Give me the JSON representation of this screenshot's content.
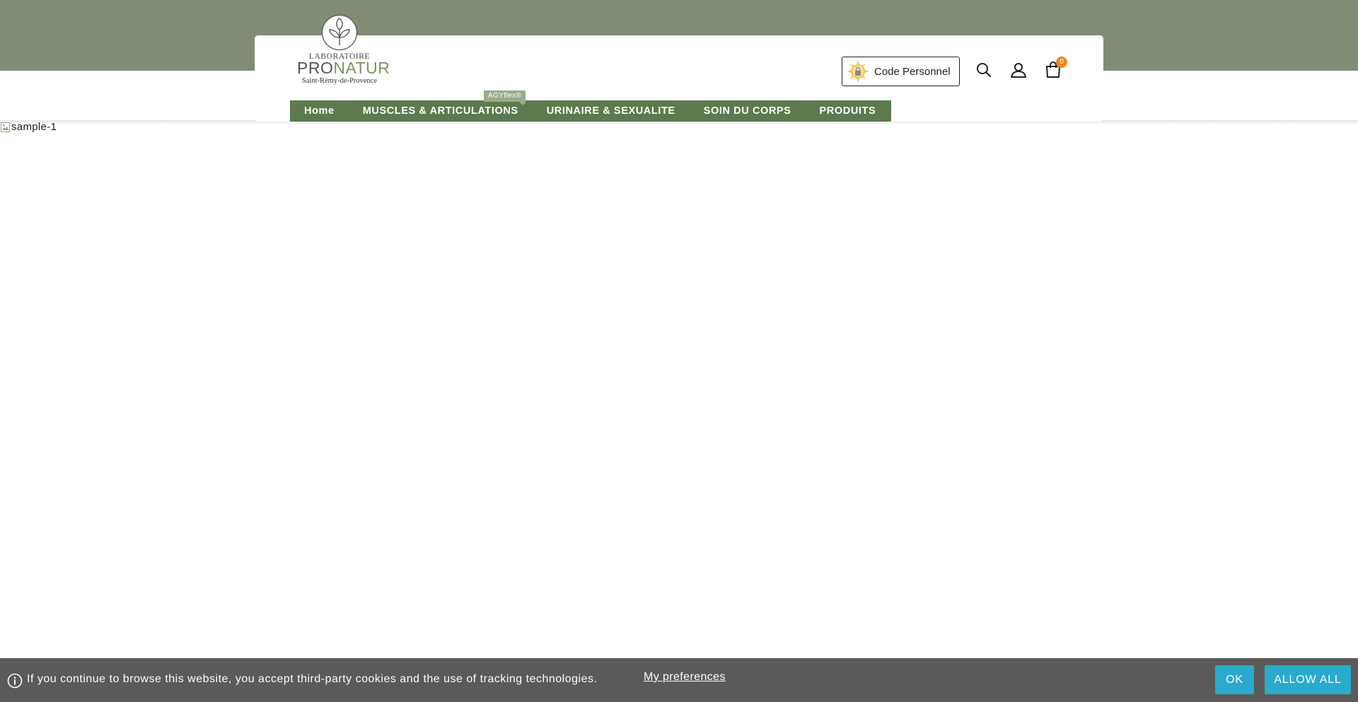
{
  "header": {
    "logo": {
      "line1": "LABORATOIRE",
      "brand_pro": "PRO",
      "brand_natur": "NATUR",
      "place": "Saint-Rémy-de-Provence"
    },
    "code_button_label": "Code Personnel",
    "icons": {
      "search": "search-icon",
      "account": "user-icon",
      "cart": "shopping-bag-icon"
    },
    "cart_count": "0"
  },
  "nav": {
    "badge": "AGYflex®",
    "items": [
      {
        "label": "Home"
      },
      {
        "label": "MUSCLES & ARTICULATIONS"
      },
      {
        "label": "URINAIRE & SEXUALITE"
      },
      {
        "label": "SOIN DU CORPS"
      },
      {
        "label": "PRODUITS"
      }
    ]
  },
  "main": {
    "image_alt": "sample-1"
  },
  "cookie": {
    "text": "If you continue to browse this website, you accept third-party cookies and the use of tracking technologies.",
    "preferences_label": "My preferences",
    "ok_label": "OK",
    "allow_all_label": "ALLOW ALL"
  },
  "colors": {
    "topbar": "#808c73",
    "nav_bg": "#5c7a4e",
    "badge_bg": "#9aab8a",
    "cart_badge": "#e88a1a",
    "cookie_bg": "#5a5a5a",
    "cookie_button": "#2aaacd"
  }
}
